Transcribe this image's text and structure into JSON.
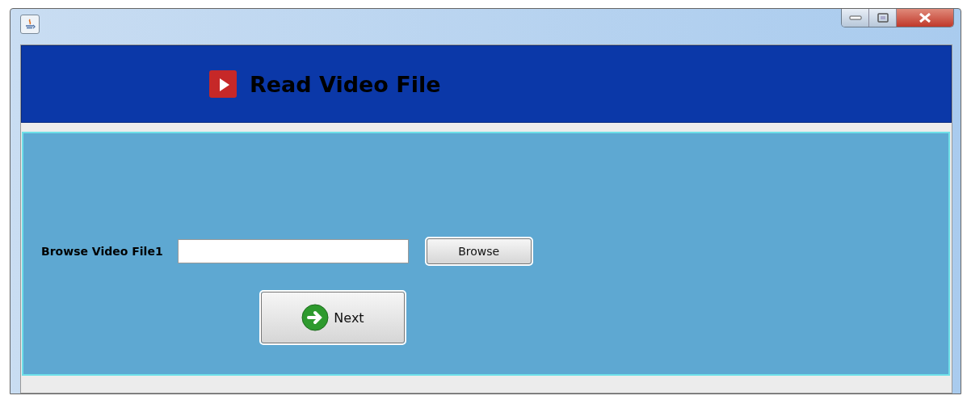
{
  "header": {
    "title": "Read Video File"
  },
  "form": {
    "label": "Browse Video File1",
    "browse_button": "Browse",
    "next_button": "Next"
  }
}
